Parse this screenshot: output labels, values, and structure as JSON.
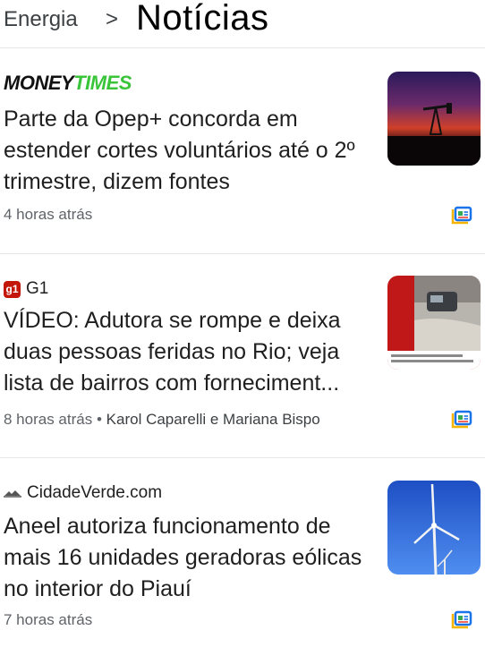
{
  "header": {
    "breadcrumb": "Energia",
    "separator": ">",
    "title": "Notícias"
  },
  "articles": [
    {
      "source_part1": "MONEY",
      "source_part2": "TIMES",
      "headline": "Parte da Opep+ concorda em estender cortes voluntários até o 2º trimestre, dizem fontes",
      "time": "4 horas atrás",
      "authors": "",
      "thumbnail": "oil-pumpjack-sunset-image"
    },
    {
      "source_badge": "g1",
      "source": "G1",
      "headline": "VÍDEO: Adutora se rompe e deixa duas pessoas feridas no Rio; veja lista de bairros com forneciment...",
      "time": "8 horas atrás",
      "separator": "•",
      "authors": "Karol Caparelli e Mariana Bispo",
      "thumbnail": "flooded-street-video-image"
    },
    {
      "source": "CidadeVerde.com",
      "headline": "Aneel autoriza funcionamento de mais 16 unidades geradoras eólicas no interior do Piauí",
      "time": "7 horas atrás",
      "authors": "",
      "thumbnail": "wind-turbines-sky-image"
    }
  ],
  "icons": {
    "save": "full-coverage-icon",
    "cidadeverde": "cidadeverde-logo-icon"
  },
  "colors": {
    "moneytimes_green": "#39c43a",
    "g1_red": "#c4170c",
    "text": "#1f1f1f",
    "meta": "#5f6368"
  }
}
